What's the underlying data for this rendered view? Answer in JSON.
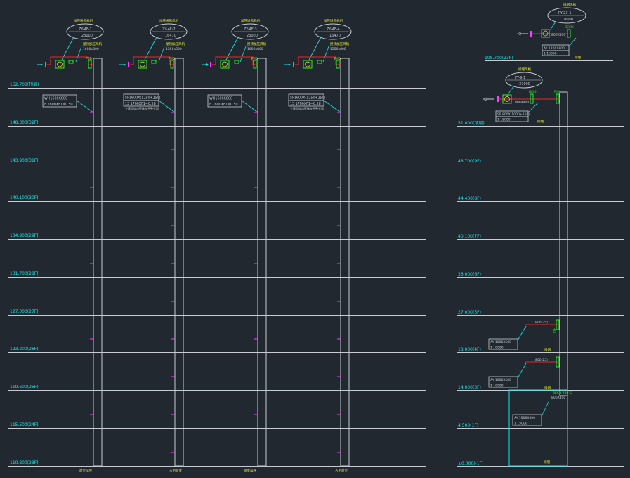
{
  "colors": {
    "background": "#212830",
    "line": "#c8ccd2",
    "cyan": "#19e6e6",
    "green": "#2cf02c",
    "yellow": "#f0f02a",
    "red": "#e8282a",
    "magenta": "#ff3cff"
  },
  "left_levels": [
    "152.700(顶层)",
    "148.300(32F)",
    "143.900(31F)",
    "140.100(30F)",
    "134.900(29F)",
    "131.700(28F)",
    "127.000(27F)",
    "123.200(26F)",
    "119.600(25F)",
    "115.500(24F)",
    "110.800(23F)"
  ],
  "right_levels": [
    "51.000(顶层)",
    "48.700(9F)",
    "44.400(8F)",
    "40.100(7F)",
    "36.000(6F)",
    "27.000(5F)",
    "18.000(4F)",
    "14.000(3F)",
    "4.500(1F)",
    "±0.000(-1F)"
  ],
  "right_roof_level": "108.700(23F)",
  "fans": [
    {
      "code": "ZY-4F-1",
      "flow": "23000",
      "top_note": "加压送风机组",
      "unit_note": "屋顶加压风机",
      "size": "1600x800"
    },
    {
      "code": "ZY-4F-2",
      "flow": "16470",
      "top_note": "加压送风机组",
      "unit_note": "屋顶加压风机",
      "size": "1250x800"
    },
    {
      "code": "ZY-4F-3",
      "flow": "23000",
      "top_note": "加压送风机组",
      "unit_note": "屋顶加压风机",
      "size": "1600x800"
    },
    {
      "code": "ZY-4F-4",
      "flow": "16470",
      "top_note": "加压送风机组",
      "unit_note": "屋顶加压风机",
      "size": "1250x800"
    }
  ],
  "annotations": [
    {
      "line1": "WH1600X800",
      "line2": "8 2800XF1=0.50"
    },
    {
      "line1": "SP1600X(1250+250)",
      "line2": "13 1700XF1=0.58",
      "line3": "土建风道内壁抹灰平整光滑"
    },
    {
      "line1": "WH1600X800",
      "line2": "8 2800XF1=0.50"
    },
    {
      "line1": "SP1600X(1250+250)",
      "line2": "13 1700XF1=0.58",
      "line3": "土建风道内壁抹灰平整光滑"
    }
  ],
  "shaft_labels": [
    "前室加压",
    "合用前室",
    "前室加压",
    "合用前室"
  ],
  "fan_tags": [
    "FYD",
    "FYD",
    "FYD",
    "FYD"
  ],
  "right_fans": [
    {
      "title": "排烟风机",
      "code": "PY-23-1",
      "flow": "18000",
      "size": "800X400",
      "tag": "BECH"
    },
    {
      "title": "排烟风机",
      "code": "PY-9-1",
      "flow": "37000",
      "size": "800X400",
      "tag": "BECH"
    }
  ],
  "right_tags": [
    "FYH",
    "FYH"
  ],
  "right_boxes": [
    {
      "line1": "AY 1200X800",
      "line2": "1 15000"
    },
    {
      "line1": "SP 800X(1000+250)",
      "line2": "1 18000"
    },
    {
      "line1": "AY 1000X500",
      "line2": "1 10000"
    },
    {
      "line1": "AY 1000X500",
      "line2": "1 10000"
    },
    {
      "line1": "AY 1500X800",
      "line2": "1 15000"
    }
  ],
  "right_labels": [
    "排烟",
    "排烟",
    "排烟",
    "排烟",
    "排烟"
  ],
  "branch_labels": [
    "800(25)",
    "800(25)"
  ],
  "bottom_tag": "BECH 280℃",
  "bottom_size": "800X400"
}
